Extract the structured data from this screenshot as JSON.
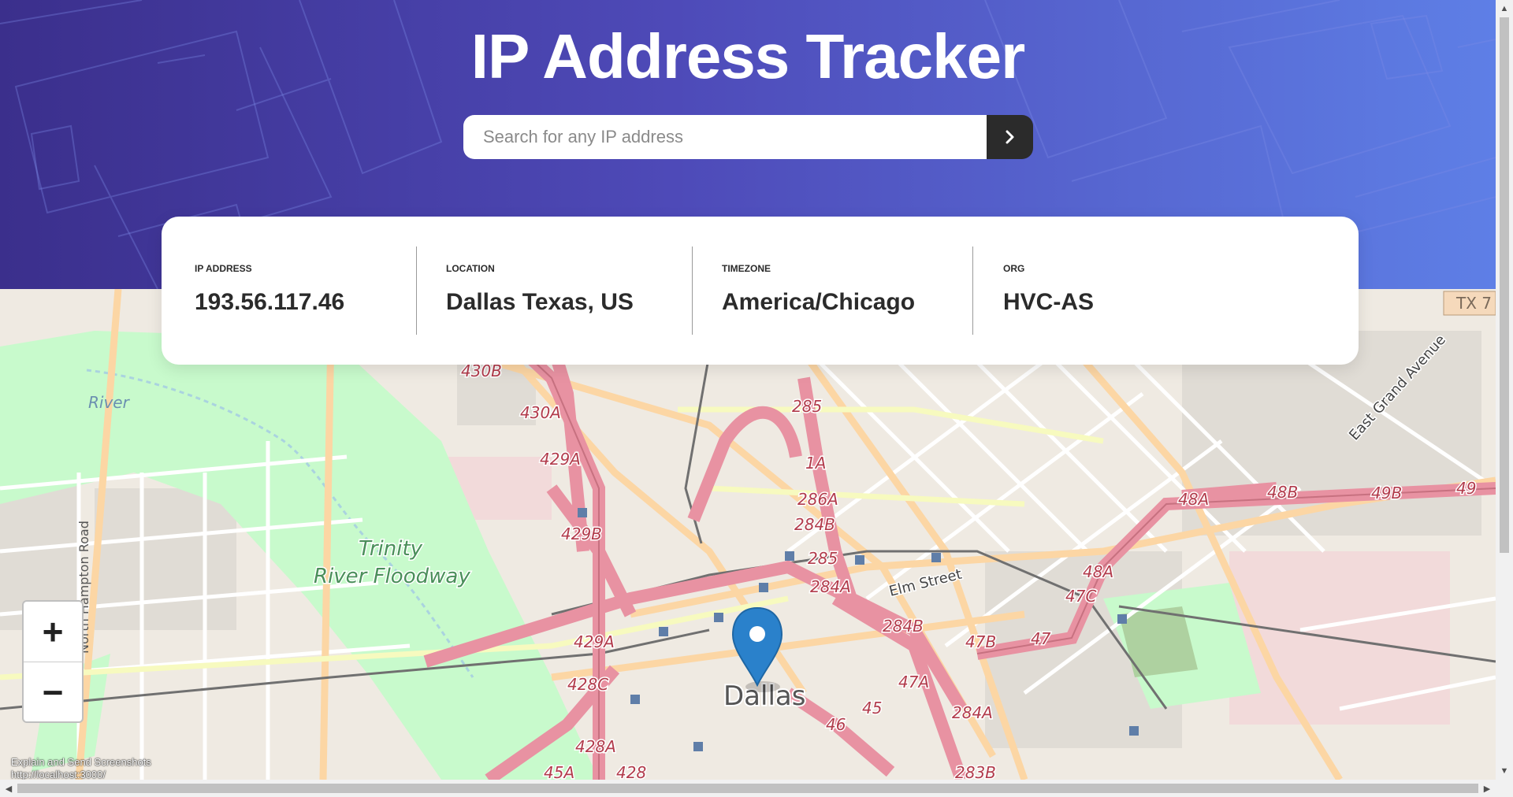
{
  "header": {
    "title": "IP Address Tracker",
    "background_colors": [
      "#3b2f8c",
      "#5e7fe6"
    ]
  },
  "search": {
    "placeholder": "Search for any IP address",
    "value": "",
    "submit_icon": "chevron-right-icon"
  },
  "info": [
    {
      "label": "IP ADDRESS",
      "value": "193.56.117.46"
    },
    {
      "label": "LOCATION",
      "value": "Dallas Texas, US"
    },
    {
      "label": "TIMEZONE",
      "value": "America/Chicago"
    },
    {
      "label": "ORG",
      "value": "HVC-AS"
    }
  ],
  "map": {
    "zoom_in_label": "+",
    "zoom_out_label": "−",
    "city_label": "Dallas",
    "area_label_1": "Trinity",
    "area_label_2": "River Floodway",
    "river_label": "River",
    "road_labels": [
      "North Hampton Road",
      "Elm Street",
      "East Grand Avenue"
    ],
    "shield_label": "TX 7",
    "exit_labels": [
      "430B",
      "430A",
      "429A",
      "429B",
      "285",
      "1A",
      "286A",
      "284B",
      "285",
      "284A",
      "284B",
      "47B",
      "47",
      "47A",
      "284A",
      "283B",
      "46",
      "45",
      "429A",
      "428C",
      "428A",
      "428",
      "45A",
      "48A",
      "48B",
      "49B",
      "49",
      "48A",
      "47C"
    ],
    "marker_icon": "map-pin-icon",
    "marker_color": "#2a81cb",
    "highway_color": "#e892a2",
    "primary_road_color": "#fcd6a4",
    "park_color": "#c8facc"
  },
  "overlay": {
    "line1": "Explain and Send Screenshots",
    "line2": "http://localhost:3000/"
  },
  "scrollbars": {
    "up": "▲",
    "down": "▼",
    "left": "◀",
    "right": "▶"
  }
}
